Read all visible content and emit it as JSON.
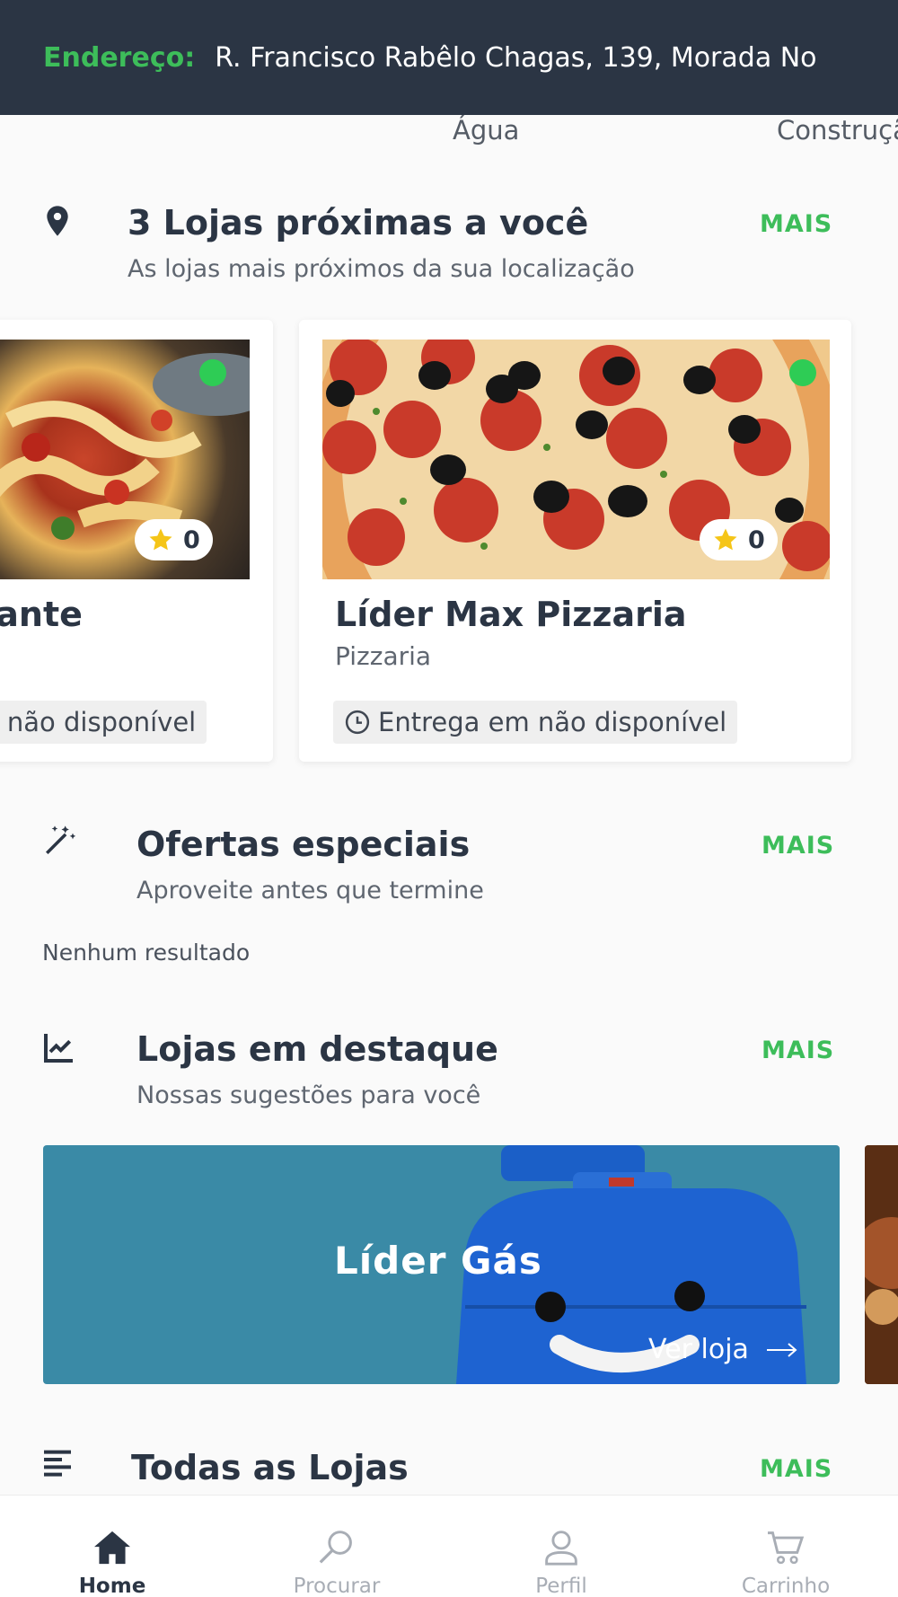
{
  "header": {
    "address_label": "Endereço:",
    "address": "R. Francisco Rabêlo Chagas, 139, Morada No"
  },
  "categories": [
    "Água",
    "Construção"
  ],
  "nearby": {
    "title": "3 Lojas próximas a você",
    "subtitle": "As lojas mais próximos da sua localização",
    "more": "MAIS",
    "icon": "map-pin-icon",
    "stores": [
      {
        "name": "Restaurante",
        "category": "",
        "rating": "0",
        "delivery": "Entrega em não disponível",
        "open_color": "#2ecc55"
      },
      {
        "name": "Líder Max Pizzaria",
        "category": "Pizzaria",
        "rating": "0",
        "delivery": "Entrega em não disponível",
        "open_color": "#2ecc55"
      }
    ]
  },
  "offers": {
    "title": "Ofertas especiais",
    "subtitle": "Aproveite antes que termine",
    "more": "MAIS",
    "icon": "magic-wand-icon",
    "empty": "Nenhum resultado"
  },
  "featured": {
    "title": "Lojas em destaque",
    "subtitle": "Nossas sugestões para você",
    "more": "MAIS",
    "icon": "trending-chart-icon",
    "banner": {
      "name": "Líder Gás",
      "link": "Ver loja"
    }
  },
  "all_stores": {
    "title": "Todas as Lojas",
    "more": "MAIS",
    "icon": "list-lines-icon"
  },
  "nav": [
    {
      "label": "Home",
      "icon": "home-icon",
      "active": true
    },
    {
      "label": "Procurar",
      "icon": "search-icon",
      "active": false
    },
    {
      "label": "Perfil",
      "icon": "user-icon",
      "active": false
    },
    {
      "label": "Carrinho",
      "icon": "cart-icon",
      "active": false
    }
  ],
  "colors": {
    "accent": "#3dbd5a",
    "header_bg": "#2b3544",
    "banner_bg": "#3a8aa6"
  }
}
